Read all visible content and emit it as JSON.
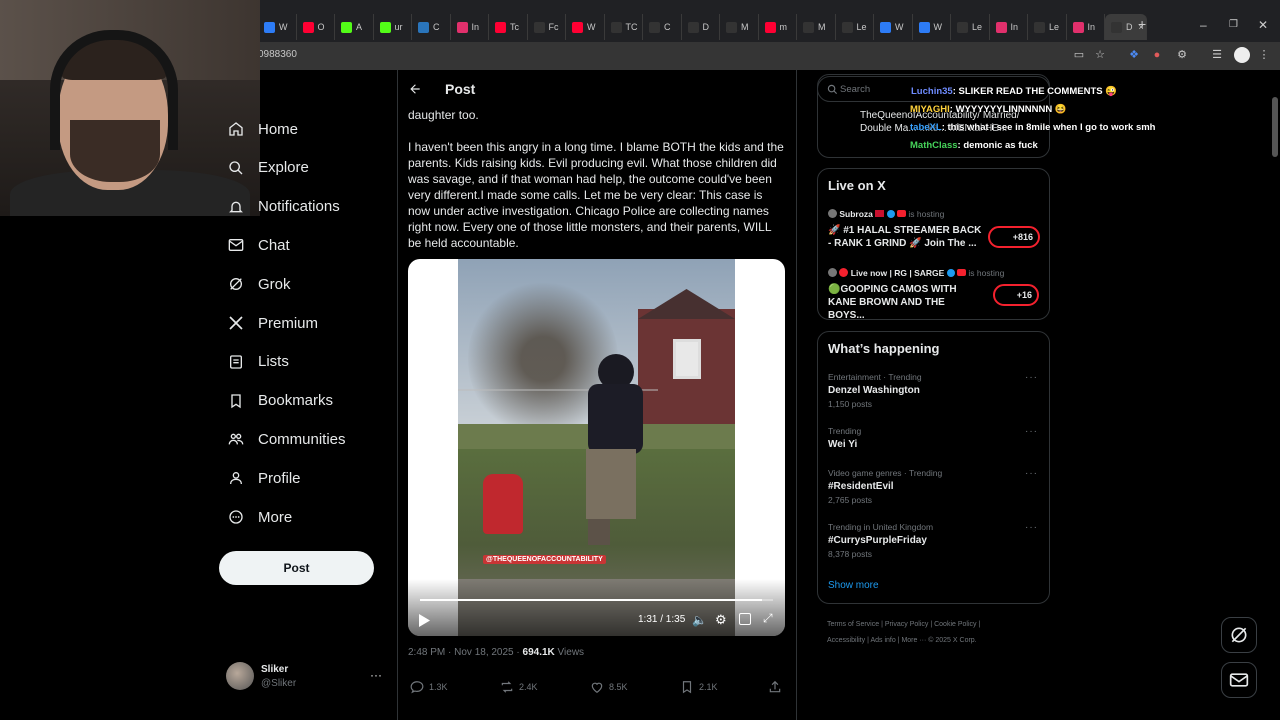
{
  "browser": {
    "tabs": [
      {
        "icon": "bing-icon",
        "label": "W",
        "color": "#2d7cf6"
      },
      {
        "icon": "youtube-icon",
        "label": "O",
        "color": "#ff0033"
      },
      {
        "icon": "kick-icon",
        "label": "A",
        "color": "#53fc18"
      },
      {
        "icon": "kick-icon",
        "label": "ur",
        "color": "#53fc18"
      },
      {
        "icon": "steam-icon",
        "label": "C",
        "color": "#2a75bb"
      },
      {
        "icon": "instagram-icon",
        "label": "In",
        "color": "#e1306c"
      },
      {
        "icon": "youtube-icon",
        "label": "Tc",
        "color": "#ff0033"
      },
      {
        "icon": "x-icon",
        "label": "Fc",
        "color": "#333333"
      },
      {
        "icon": "youtube-icon",
        "label": "W",
        "color": "#ff0033"
      },
      {
        "icon": "x-icon",
        "label": "TC",
        "color": "#333333"
      },
      {
        "icon": "x-icon",
        "label": "C",
        "color": "#333333"
      },
      {
        "icon": "x-icon",
        "label": "D",
        "color": "#333333"
      },
      {
        "icon": "x-icon",
        "label": "M",
        "color": "#333333"
      },
      {
        "icon": "youtube-icon",
        "label": "m",
        "color": "#ff0033"
      },
      {
        "icon": "x-icon",
        "label": "M",
        "color": "#333333"
      },
      {
        "icon": "x-icon",
        "label": "Le",
        "color": "#333333"
      },
      {
        "icon": "bing-icon",
        "label": "W",
        "color": "#2d7cf6"
      },
      {
        "icon": "bing-icon",
        "label": "W",
        "color": "#2d7cf6"
      },
      {
        "icon": "x-icon",
        "label": "Le",
        "color": "#333333"
      },
      {
        "icon": "instagram-icon",
        "label": "In",
        "color": "#e1306c"
      },
      {
        "icon": "x-icon",
        "label": "Le",
        "color": "#333333"
      },
      {
        "icon": "instagram-icon",
        "label": "In",
        "color": "#e1306c"
      },
      {
        "icon": "x-icon",
        "label": "D",
        "color": "#333333"
      }
    ],
    "url_fragment": "0988360",
    "new_tab": "+",
    "close_tab": "×"
  },
  "nav": {
    "items": [
      {
        "label": "Home",
        "icon": "home-icon"
      },
      {
        "label": "Explore",
        "icon": "search-icon"
      },
      {
        "label": "Notifications",
        "icon": "bell-icon"
      },
      {
        "label": "Chat",
        "icon": "envelope-icon"
      },
      {
        "label": "Grok",
        "icon": "grok-icon"
      },
      {
        "label": "Premium",
        "icon": "x-logo-icon"
      },
      {
        "label": "Lists",
        "icon": "list-icon"
      },
      {
        "label": "Bookmarks",
        "icon": "bookmark-icon"
      },
      {
        "label": "Communities",
        "icon": "people-icon"
      },
      {
        "label": "Profile",
        "icon": "person-icon"
      },
      {
        "label": "More",
        "icon": "more-circle-icon"
      }
    ],
    "post_button": "Post"
  },
  "account": {
    "name": "Sliker",
    "handle": "@Sliker",
    "more": "···"
  },
  "post": {
    "header_title": "Post",
    "text_top": "daughter too.",
    "text_body": "I haven't been this angry in a long time. I blame BOTH the kids and the parents. Kids raising kids. Evil producing evil. What those children did was savage, and if that woman had help, the outcome could've been very different.I made some calls. Let me be very clear: This case is now under active investigation. Chicago Police are collecting names right now. Every one of those little monsters, and their parents, WILL be held accountable.",
    "video": {
      "watermark": "@THEQUEENOFACCOUNTABILITY",
      "time": "1:31 / 1:35",
      "progress": 0.968
    },
    "timestamp": "2:48 PM · Nov 18, 2025 ·",
    "views_count": "694.1K",
    "views_label": "Views",
    "replies": "1.3K",
    "reposts": "2.4K",
    "likes": "8.5K",
    "bookmarks": "2.1K"
  },
  "sidebar": {
    "search_placeholder": "Search",
    "profile_snippet": "TheQueenofAccountability/ Married/ Double Ma... ...ke... MENtal HE...",
    "live": {
      "title": "Live on X",
      "items": [
        {
          "host": "Subroza",
          "hosting": "is hosting",
          "title": "🚀 #1 HALAL STREAMER BACK - RANK 1 GRIND 🚀 Join The ...",
          "count": "+816"
        },
        {
          "host": "Live now | RG | SARGE",
          "hosting": "is hosting",
          "title": "🟢GOOPING CAMOS WITH KANE BROWN AND THE BOYS...",
          "count": "+16"
        }
      ]
    },
    "happening": {
      "title": "What’s happening",
      "trends": [
        {
          "category": "Entertainment · Trending",
          "name": "Denzel Washington",
          "count": "1,150 posts"
        },
        {
          "category": "Trending",
          "name": "Wei Yi",
          "count": ""
        },
        {
          "category": "Video game genres · Trending",
          "name": "#ResidentEvil",
          "count": "2,765 posts"
        },
        {
          "category": "Trending in United Kingdom",
          "name": "#CurrysPurpleFriday",
          "count": "8,378 posts"
        }
      ],
      "show_more": "Show more"
    },
    "footer": {
      "line1": "Terms of Service  |  Privacy Policy  |  Cookie Policy  |",
      "line2": "Accessibility  |  Ads info  |  More ···  © 2025 X Corp."
    }
  },
  "chat": [
    {
      "user": "Luchin35",
      "color": "#6f8cff",
      "text": ": SLIKER READ THE COMMENTS 😜"
    },
    {
      "user": "MIYAGHI",
      "color": "#ffd23c",
      "text": ": WYYYYYYLINNNNNN 😆"
    },
    {
      "user": "tabeXL",
      "color": "#3aa3ff",
      "text": ": this what i see in 8mile when I go to work smh"
    },
    {
      "user": "MathClass",
      "color": "#46d35a",
      "text": ": demonic as fuck"
    }
  ],
  "colors": {
    "accent": "#1d9bf0",
    "live_red": "#f4212e",
    "muted": "#71767b"
  }
}
